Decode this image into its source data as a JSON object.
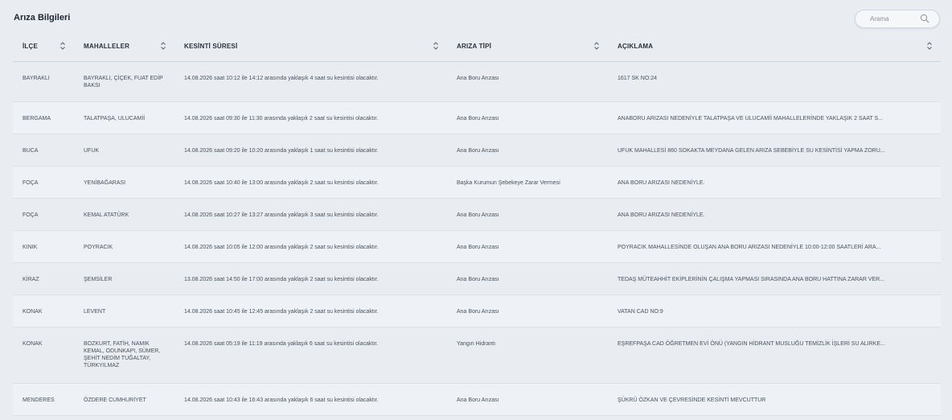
{
  "page": {
    "title": "Arıza Bilgileri",
    "search_placeholder": "Arama",
    "search_icon": "search-icon",
    "sort_icon": "sort-chevrons-icon"
  },
  "columns": [
    "İLÇE",
    "MAHALLELER",
    "KESİNTİ SÜRESİ",
    "ARIZA TİPİ",
    "AÇIKLAMA"
  ],
  "rows": [
    {
      "ilce": "BAYRAKLI",
      "mahalle": "BAYRAKLI, ÇİÇEK, FUAT EDİP BAKSI",
      "sure": "14.08.2026 saat 10:12 ile 14:12 arasında yaklaşık 4 saat su kesintisi olacaktır.",
      "tip": "Ana Boru Arızası",
      "aciklama": "1617 SK NO:24"
    },
    {
      "ilce": "BERGAMA",
      "mahalle": "TALATPAŞA, ULUCAMİİ",
      "sure": "14.08.2026 saat 09:30 ile 11:30 arasında yaklaşık 2 saat su kesintisi olacaktır.",
      "tip": "Ana Boru Arızası",
      "aciklama": "ANABORU ARIZASI NEDENİYLE TALATPAŞA VE ULUCAMİİ MAHALLELERİNDE YAKLAŞIK 2 SAAT S..."
    },
    {
      "ilce": "BUCA",
      "mahalle": "UFUK",
      "sure": "14.08.2026 saat 09:20 ile 10:20 arasında yaklaşık 1 saat su kesintisi olacaktır.",
      "tip": "Ana Boru Arızası",
      "aciklama": "UFUK MAHALLESİ 860 SOKAKTA MEYDANA GELEN ARIZA SEBEBİYLE SU KESİNTİSİ YAPMA ZORU..."
    },
    {
      "ilce": "FOÇA",
      "mahalle": "YENİBAĞARASI",
      "sure": "14.08.2026 saat 10:40 ile 13:00 arasında yaklaşık 2 saat su kesintisi olacaktır.",
      "tip": "Başka Kurumun Şebekeye Zarar Vermesi",
      "aciklama": "ANA BORU ARIZASI NEDENİYLE."
    },
    {
      "ilce": "FOÇA",
      "mahalle": "KEMAL ATATÜRK",
      "sure": "14.08.2026 saat 10:27 ile 13:27 arasında yaklaşık 3 saat su kesintisi olacaktır.",
      "tip": "Ana Boru Arızası",
      "aciklama": "ANA BORU ARIZASI NEDENİYLE."
    },
    {
      "ilce": "KINIK",
      "mahalle": "POYRACIK",
      "sure": "14.08.2026 saat 10:05 ile 12:00 arasında yaklaşık 2 saat su kesintisi olacaktır.",
      "tip": "Ana Boru Arızası",
      "aciklama": "POYRACIK MAHALLESİNDE OLUŞAN ANA BORU ARIZASI NEDENİYLE 10:00-12:00 SAATLERİ ARA..."
    },
    {
      "ilce": "KİRAZ",
      "mahalle": "ŞEMSİLER",
      "sure": "13.08.2026 saat 14:50 ile 17:00 arasında yaklaşık 2 saat su kesintisi olacaktır.",
      "tip": "Ana Boru Arızası",
      "aciklama": "TEDAŞ MÜTEAHHİT EKİPLERİNİN ÇALIŞMA YAPMASI SIRASINDA ANA BORU HATTINA ZARAR VER..."
    },
    {
      "ilce": "KONAK",
      "mahalle": "LEVENT",
      "sure": "14.08.2026 saat 10:45 ile 12:45 arasında yaklaşık 2 saat su kesintisi olacaktır.",
      "tip": "Ana Boru Arızası",
      "aciklama": "VATAN CAD NO:9"
    },
    {
      "ilce": "KONAK",
      "mahalle": "BOZKURT, FATİH, NAMIK KEMAL, ODUNKAPI, SÜMER, ŞEHİT NEDİM TUĞALTAY, TÜRKYILMAZ",
      "sure": "14.08.2026 saat 05:19 ile 11:19 arasında yaklaşık 6 saat su kesintisi olacaktır.",
      "tip": "Yangın Hidrantı",
      "aciklama": "EŞREFPAŞA CAD ÖĞRETMEN EVİ ÖNÜ (YANGIN HİDRANT MUSLUĞU TEMİZLİK İŞLERİ SU ALIRKE..."
    },
    {
      "ilce": "MENDERES",
      "mahalle": "ÖZDERE CUMHURİYET",
      "sure": "14.08.2026 saat 10:43 ile 16:43 arasında yaklaşık 6 saat su kesintisi olacaktır.",
      "tip": "Ana Boru Arızası",
      "aciklama": "ŞÜKRÜ ÖZKAN VE ÇEVRESİNDE KESİNTİ MEVCUTTUR"
    }
  ]
}
